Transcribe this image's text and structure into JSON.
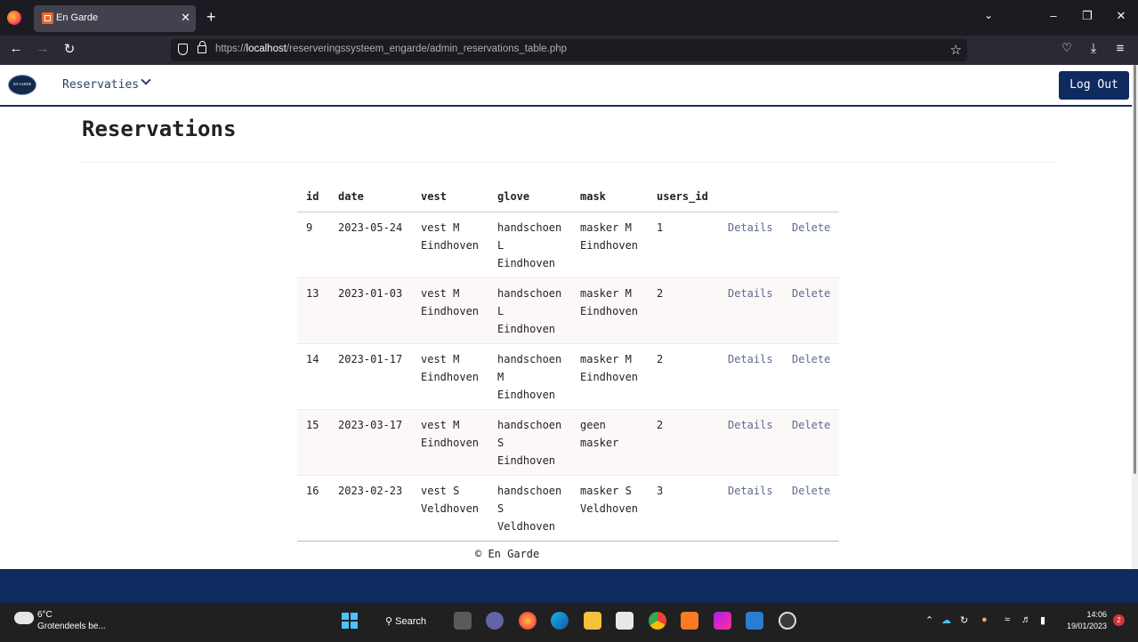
{
  "browser": {
    "tab_title": "En Garde",
    "tab_close": "✕",
    "new_tab": "+",
    "url_prefix": "https://",
    "url_host": "localhost",
    "url_path": "/reserveringssysteem_engarde/admin_reservations_table.php"
  },
  "header": {
    "logo_text": "EN GARDE",
    "menu_label": "Reservaties",
    "logout_label": "Log Out"
  },
  "main": {
    "title": "Reservations",
    "columns": [
      "id",
      "date",
      "vest",
      "glove",
      "mask",
      "users_id"
    ],
    "details_label": "Details",
    "delete_label": "Delete",
    "rows": [
      {
        "id": "9",
        "date": "2023-05-24",
        "vest": "vest M Eindhoven",
        "glove": "handschoen L Eindhoven",
        "mask": "masker M Eindhoven",
        "users_id": "1"
      },
      {
        "id": "13",
        "date": "2023-01-03",
        "vest": "vest M Eindhoven",
        "glove": "handschoen L Eindhoven",
        "mask": "masker M Eindhoven",
        "users_id": "2"
      },
      {
        "id": "14",
        "date": "2023-01-17",
        "vest": "vest M Eindhoven",
        "glove": "handschoen M Eindhoven",
        "mask": "masker M Eindhoven",
        "users_id": "2"
      },
      {
        "id": "15",
        "date": "2023-03-17",
        "vest": "vest M Eindhoven",
        "glove": "handschoen S Eindhoven",
        "mask": "geen masker",
        "users_id": "2"
      },
      {
        "id": "16",
        "date": "2023-02-23",
        "vest": "vest S Veldhoven",
        "glove": "handschoen S Veldhoven",
        "mask": "masker S Veldhoven",
        "users_id": "3"
      }
    ]
  },
  "footer": {
    "text": "© En Garde"
  },
  "taskbar": {
    "temperature": "6°C",
    "forecast": "Grotendeels be...",
    "search_label": "Search",
    "time": "14:06",
    "date": "19/01/2023",
    "notification_count": "2"
  },
  "colors": {
    "brand_navy": "#0f2a5e",
    "link": "#5c6b91"
  }
}
